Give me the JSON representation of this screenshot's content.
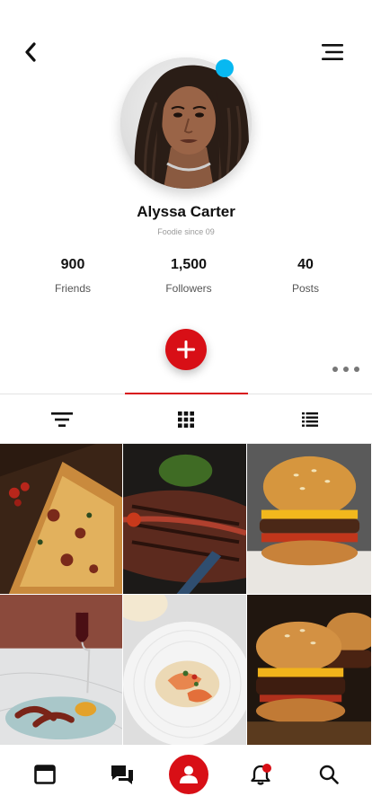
{
  "profile": {
    "name": "Alyssa Carter",
    "subtitle": "Foodie since 09",
    "online_color": "#08b8f1"
  },
  "stats": [
    {
      "value": "900",
      "label": "Friends"
    },
    {
      "value": "1,500",
      "label": "Followers"
    },
    {
      "value": "40",
      "label": "Posts"
    }
  ],
  "colors": {
    "accent": "#d80f16",
    "online": "#08b8f1"
  },
  "icons": {
    "back": "chevron-left-icon",
    "menu": "hamburger-menu-icon",
    "add": "plus-icon",
    "more": "more-horizontal-icon",
    "filter": "filter-icon",
    "grid": "grid-icon",
    "list": "list-icon",
    "nav": [
      "browser-window-icon",
      "chat-icon",
      "user-icon",
      "bell-icon",
      "search-icon"
    ]
  },
  "tabs": [
    {
      "name": "filter",
      "active": false
    },
    {
      "name": "grid",
      "active": true
    },
    {
      "name": "list",
      "active": false
    }
  ],
  "gallery": [
    "pizza",
    "steak",
    "burger",
    "octopus",
    "shrimp",
    "burgers"
  ]
}
